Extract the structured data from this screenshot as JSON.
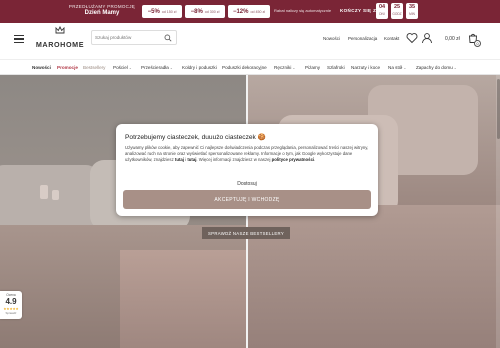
{
  "promo": {
    "headline_line1": "PRZEDŁUŻAMY PROMOCJĘ",
    "headline_line2": "Dzień Mamy",
    "coupons": [
      {
        "discount": "−5%",
        "condition": "od 150 zł"
      },
      {
        "discount": "−8%",
        "condition": "od 300 zł"
      },
      {
        "discount": "−12%",
        "condition": "od 450 zł"
      }
    ],
    "note": "Rabat naliczy się automatycznie",
    "ends_label": "KOŃCZY SIĘ ZA",
    "countdown": [
      {
        "value": "04",
        "unit": "DNI"
      },
      {
        "value": "25",
        "unit": "GODZ"
      },
      {
        "value": "35",
        "unit": "MIN"
      }
    ],
    "colors": {
      "background": "#7a2536"
    }
  },
  "header": {
    "logo_text": "MAROHOME",
    "search_placeholder": "Szukaj produktów",
    "links": [
      "Nowości",
      "Personalizacja",
      "Kontakt"
    ],
    "cart_total": "0,00 zł",
    "cart_count": "0",
    "icons": [
      "hamburger-menu-icon",
      "crown-icon",
      "search-icon",
      "heart-icon",
      "user-icon",
      "cart-icon"
    ]
  },
  "nav": {
    "items": [
      {
        "label": "Nowości",
        "color": "#333333",
        "bold": true,
        "dropdown": false
      },
      {
        "label": "Promocje",
        "color": "#b23a48",
        "bold": true,
        "dropdown": false
      },
      {
        "label": "Bestsellery",
        "color": "#9a8a80",
        "bold": false,
        "dropdown": false
      },
      {
        "label": "Pościel",
        "color": "#333333",
        "bold": false,
        "dropdown": true
      },
      {
        "label": "Prześcieradła",
        "color": "#333333",
        "bold": false,
        "dropdown": true
      },
      {
        "label": "Koldry i poduszki",
        "color": "#333333",
        "bold": false,
        "dropdown": false
      },
      {
        "label": "Poduszki dekoracyjne",
        "color": "#333333",
        "bold": false,
        "dropdown": false
      },
      {
        "label": "Ręczniki",
        "color": "#333333",
        "bold": false,
        "dropdown": true
      },
      {
        "label": "Piżamy",
        "color": "#333333",
        "bold": false,
        "dropdown": false
      },
      {
        "label": "Szlafroki",
        "color": "#333333",
        "bold": false,
        "dropdown": false
      },
      {
        "label": "Narzuty i koce",
        "color": "#333333",
        "bold": false,
        "dropdown": false
      },
      {
        "label": "Na stół",
        "color": "#333333",
        "bold": false,
        "dropdown": true
      },
      {
        "label": "Zapachy do domu",
        "color": "#333333",
        "bold": false,
        "dropdown": true
      }
    ]
  },
  "hero": {
    "cta_label": "SPRAWDŹ NASZE BESTSELLERY"
  },
  "rating": {
    "label": "Ocena",
    "value": "4.9",
    "stars": "★★★★★",
    "source": "Sprawdź"
  },
  "cookie": {
    "title": "Potrzebujemy ciasteczek, duuużo ciasteczek 🍪",
    "body_before_bold": "Używamy plików cookie, aby zapewnić Ci najlepsze doświadczenia podczas przeglądania, personalizować treści naszej witryny, analizować ruch na stronie oraz wyświetlać spersonalizowane reklamy. Informacje o tym, jak Google wykorzystuje dane użytkowników, znajdziesz ",
    "link_here": "tutaj",
    "between_links": " i ",
    "link_here2": "tutaj",
    "body_middle": ". Więcej informacji znajdziesz w naszej ",
    "link_policy": "polityce prywatności",
    "body_end": ".",
    "decline_label": "Dostosuj",
    "accept_label": "AKCEPTUJĘ I WCHODZĘ",
    "colors": {
      "accept_button": "#a89087"
    }
  }
}
